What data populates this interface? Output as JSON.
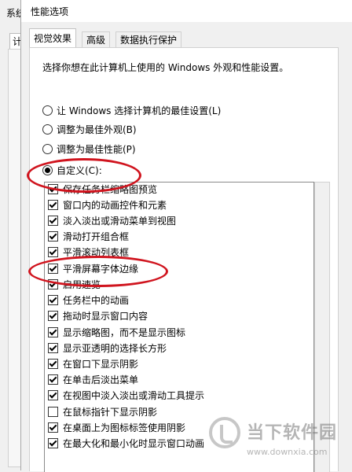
{
  "background_window": {
    "title": "系统",
    "tab_label": "计"
  },
  "dialog": {
    "title": "性能选项",
    "tabs": [
      {
        "label": "视觉效果",
        "active": true
      },
      {
        "label": "高级",
        "active": false
      },
      {
        "label": "数据执行保护",
        "active": false
      }
    ],
    "description": "选择你想在此计算机上使用的 Windows 外观和性能设置。",
    "radio_options": [
      {
        "label": "让 Windows 选择计算机的最佳设置(L)",
        "checked": false
      },
      {
        "label": "调整为最佳外观(B)",
        "checked": false
      },
      {
        "label": "调整为最佳性能(P)",
        "checked": false
      },
      {
        "label": "自定义(C):",
        "checked": true
      }
    ],
    "effects": [
      {
        "label": "保存任务栏缩略图预览",
        "checked": true
      },
      {
        "label": "窗口内的动画控件和元素",
        "checked": true
      },
      {
        "label": "淡入淡出或滑动菜单到视图",
        "checked": true
      },
      {
        "label": "滑动打开组合框",
        "checked": true
      },
      {
        "label": "平滑滚动列表框",
        "checked": true
      },
      {
        "label": "平滑屏幕字体边缘",
        "checked": true
      },
      {
        "label": "启用速览",
        "checked": true
      },
      {
        "label": "任务栏中的动画",
        "checked": true
      },
      {
        "label": "拖动时显示窗口内容",
        "checked": true
      },
      {
        "label": "显示缩略图，而不是显示图标",
        "checked": true
      },
      {
        "label": "显示亚透明的选择长方形",
        "checked": true
      },
      {
        "label": "在窗口下显示阴影",
        "checked": true
      },
      {
        "label": "在单击后淡出菜单",
        "checked": true
      },
      {
        "label": "在视图中淡入淡出或滑动工具提示",
        "checked": true
      },
      {
        "label": "在鼠标指针下显示阴影",
        "checked": false
      },
      {
        "label": "在桌面上为图标标签使用阴影",
        "checked": true
      },
      {
        "label": "在最大化和最小化时显示窗口动画",
        "checked": true
      }
    ]
  },
  "watermark": {
    "name": "当下软件园",
    "url": "www.downxia.com"
  },
  "colors": {
    "annotation": "#d0141e",
    "dialog_bg": "#f0f0f0"
  }
}
